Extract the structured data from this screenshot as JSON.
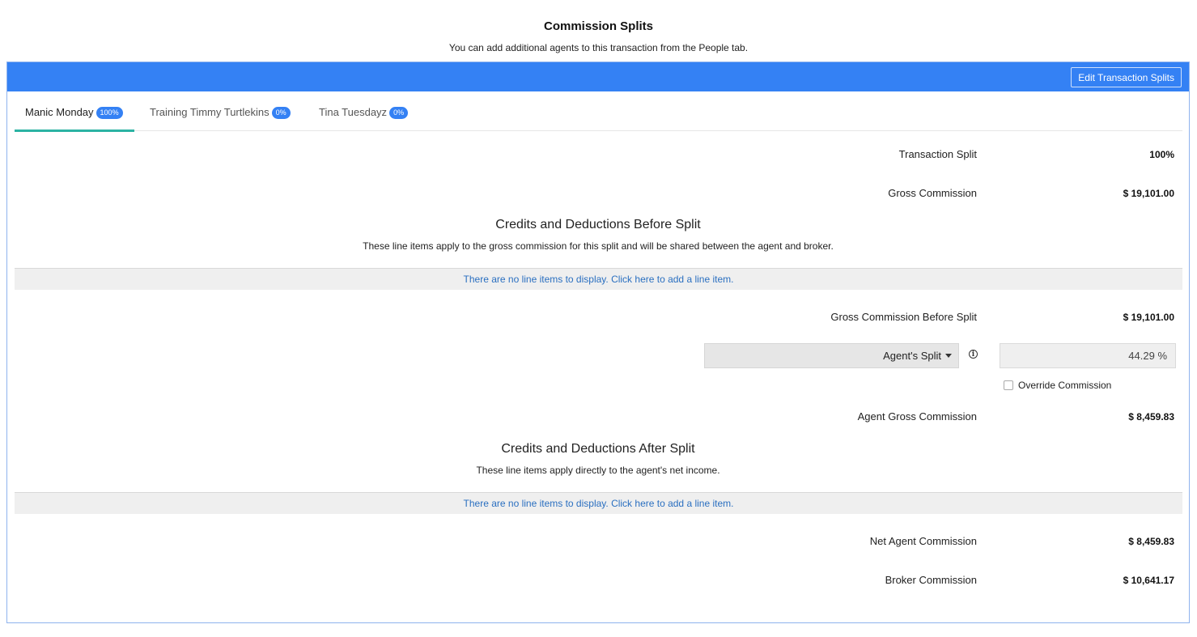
{
  "header": {
    "title": "Commission Splits",
    "subtitle": "You can add additional agents to this transaction from the People tab."
  },
  "toolbar": {
    "edit_label": "Edit Transaction Splits"
  },
  "colors": {
    "accent": "#3481f4",
    "tab_active": "#2bb3a3",
    "link": "#2a6fc0"
  },
  "tabs": [
    {
      "label": "Manic Monday",
      "badge": "100%",
      "active": true
    },
    {
      "label": "Training Timmy Turtlekins",
      "badge": "0%",
      "active": false
    },
    {
      "label": "Tina Tuesdayz",
      "badge": "0%",
      "active": false
    }
  ],
  "rows": {
    "transaction_split": {
      "label": "Transaction Split",
      "value": "100%"
    },
    "gross_commission": {
      "label": "Gross Commission",
      "value": "$ 19,101.00"
    },
    "gross_before_split": {
      "label": "Gross Commission Before Split",
      "value": "$ 19,101.00"
    },
    "agent_gross": {
      "label": "Agent Gross Commission",
      "value": "$ 8,459.83"
    },
    "net_agent": {
      "label": "Net Agent Commission",
      "value": "$ 8,459.83"
    },
    "broker": {
      "label": "Broker Commission",
      "value": "$ 10,641.17"
    }
  },
  "before_split": {
    "title": "Credits and Deductions Before Split",
    "description": "These line items apply to the gross commission for this split and will be shared between the agent and broker.",
    "empty_text": "There are no line items to display. Click here to add a line item."
  },
  "after_split": {
    "title": "Credits and Deductions After Split",
    "description": "These line items apply directly to the agent's net income.",
    "empty_text": "There are no line items to display. Click here to add a line item."
  },
  "split": {
    "select_label": "Agent's Split",
    "value": "44.29 %",
    "info_icon": "info-icon",
    "override_label": "Override Commission",
    "override_checked": false
  }
}
